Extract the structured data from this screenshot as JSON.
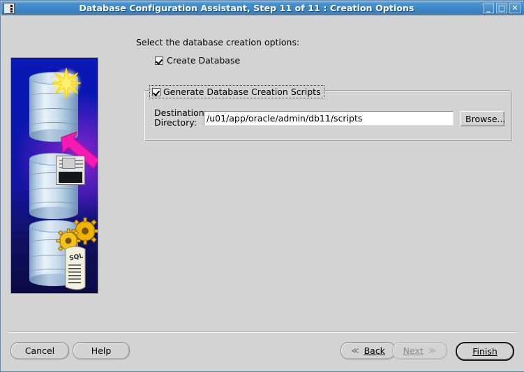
{
  "window": {
    "title": "Database Configuration Assistant, Step 11 of 11 : Creation Options",
    "icon": "app-grid-icon",
    "controls": {
      "minimize": "_",
      "maximize": "□",
      "close": "✕"
    },
    "accent_color": "#3e87c6",
    "background_color": "#d3d3d3"
  },
  "illustration": {
    "alt": "database-creation-graphic",
    "elements": [
      "database-cylinder-star",
      "magenta-arrow",
      "floppy-disk",
      "gears",
      "sql-scroll"
    ],
    "sql_label": "SQL"
  },
  "main": {
    "prompt": "Select the database creation options:",
    "create_database": {
      "label": "Create Database",
      "checked": true
    },
    "generate_scripts": {
      "label": "Generate Database Creation Scripts",
      "checked": true,
      "destination": {
        "label_line1": "Destination",
        "label_line2": "Directory:",
        "value": "/u01/app/oracle/admin/db11/scripts",
        "placeholder": "",
        "browse_label": "Browse..."
      }
    }
  },
  "footer": {
    "cancel": "Cancel",
    "help": "Help",
    "back": "Back",
    "next": "Next",
    "finish": "Finish",
    "back_chevron": "≪",
    "next_chevron": "≫",
    "next_enabled": false,
    "finish_default": true
  }
}
